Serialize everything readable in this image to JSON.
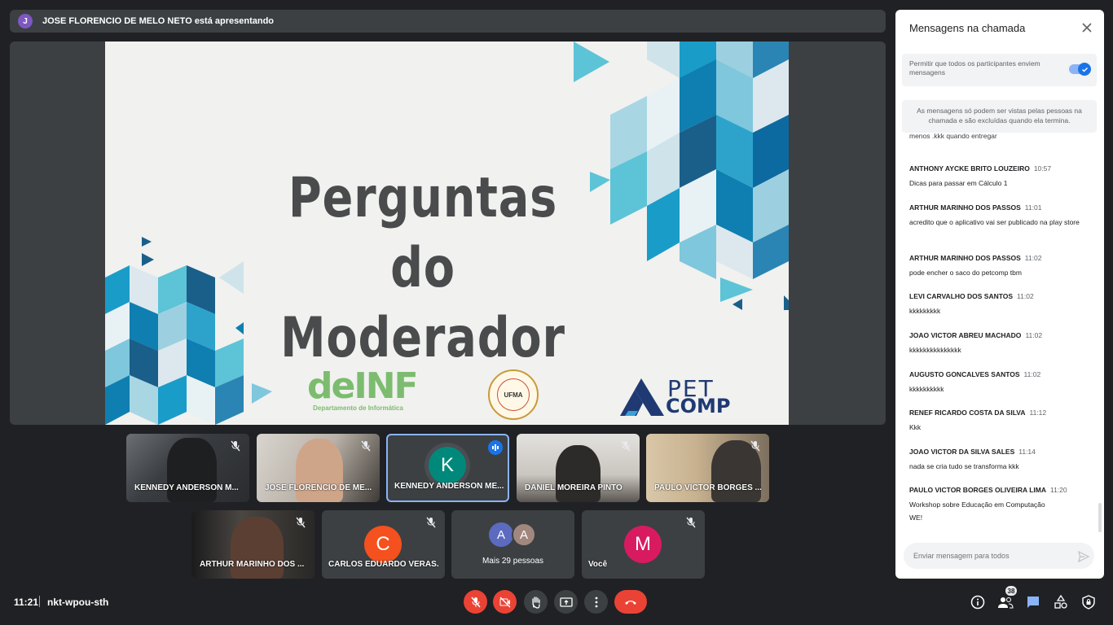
{
  "presenter": {
    "avatar_initial": "J",
    "text": "JOSE FLORENCIO DE MELO NETO está apresentando"
  },
  "slide": {
    "title_line1": "Perguntas do",
    "title_line2": "Moderador",
    "logo_definf": "deINF",
    "logo_definf_sub": "Departamento de Informática",
    "logo_ufma": "UFMA",
    "logo_pet": "PET",
    "logo_comp": "COMP"
  },
  "tiles": [
    {
      "name": "KENNEDY ANDERSON M...",
      "muted": true
    },
    {
      "name": "JOSE FLORENCIO DE ME...",
      "muted": true
    },
    {
      "name": "KENNEDY ANDERSON ME...",
      "initial": "K",
      "avatar_color": "#00897b",
      "speaking": true
    },
    {
      "name": "DANIEL MOREIRA PINTO",
      "muted": true
    },
    {
      "name": "PAULO VICTOR BORGES ...",
      "muted": true
    },
    {
      "name": "ARTHUR MARINHO DOS ...",
      "muted": true
    },
    {
      "name": "CARLOS EDUARDO VERAS...",
      "initial": "C",
      "avatar_color": "#f4511e",
      "muted": true
    },
    {
      "name": "Mais 29 pessoas",
      "initials": [
        "A",
        "A"
      ]
    },
    {
      "name": "Você",
      "initial": "M",
      "avatar_color": "#d81b60",
      "muted": true
    }
  ],
  "bottom": {
    "time": "11:21",
    "meeting_code": "nkt-wpou-sth",
    "participants_count": "38"
  },
  "chat": {
    "title": "Mensagens na chamada",
    "allow_label": "Permitir que todos os participantes enviem mensagens",
    "allow_enabled": true,
    "notice": "As mensagens só podem ser vistas pelas pessoas na chamada e são excluídas quando ela termina.",
    "partial_text": "menos .kkk quando entregar",
    "messages": [
      {
        "sender": "ANTHONY AYCKE BRITO LOUZEIRO",
        "time": "10:57",
        "text": "Dicas para passar em Cálculo 1"
      },
      {
        "sender": "ARTHUR MARINHO DOS PASSOS",
        "time": "11:01",
        "text": "acredito que o aplicativo vai ser publicado na play store"
      },
      {
        "sender": "ARTHUR MARINHO DOS PASSOS",
        "time": "11:02",
        "text": "pode encher o saco do petcomp tbm"
      },
      {
        "sender": "LEVI CARVALHO DOS SANTOS",
        "time": "11:02",
        "text": "kkkkkkkkk"
      },
      {
        "sender": "JOAO VICTOR ABREU MACHADO",
        "time": "11:02",
        "text": "kkkkkkkkkkkkkkk"
      },
      {
        "sender": "AUGUSTO GONCALVES SANTOS",
        "time": "11:02",
        "text": "kkkkkkkkkk"
      },
      {
        "sender": "RENEF RICARDO COSTA DA SILVA",
        "time": "11:12",
        "text": "Kkk"
      },
      {
        "sender": "JOAO VICTOR DA SILVA SALES",
        "time": "11:14",
        "text": "nada se cria tudo se transforma kkk"
      },
      {
        "sender": "PAULO VICTOR BORGES OLIVEIRA LIMA",
        "time": "11:20",
        "text": "Workshop sobre Educação em Computação"
      }
    ],
    "last_line": "WE!",
    "input_placeholder": "Enviar mensagem para todos"
  },
  "colors": {
    "background": "#202124",
    "surface": "#3c4043",
    "end_call": "#ea4335",
    "accent": "#1a73e8"
  }
}
